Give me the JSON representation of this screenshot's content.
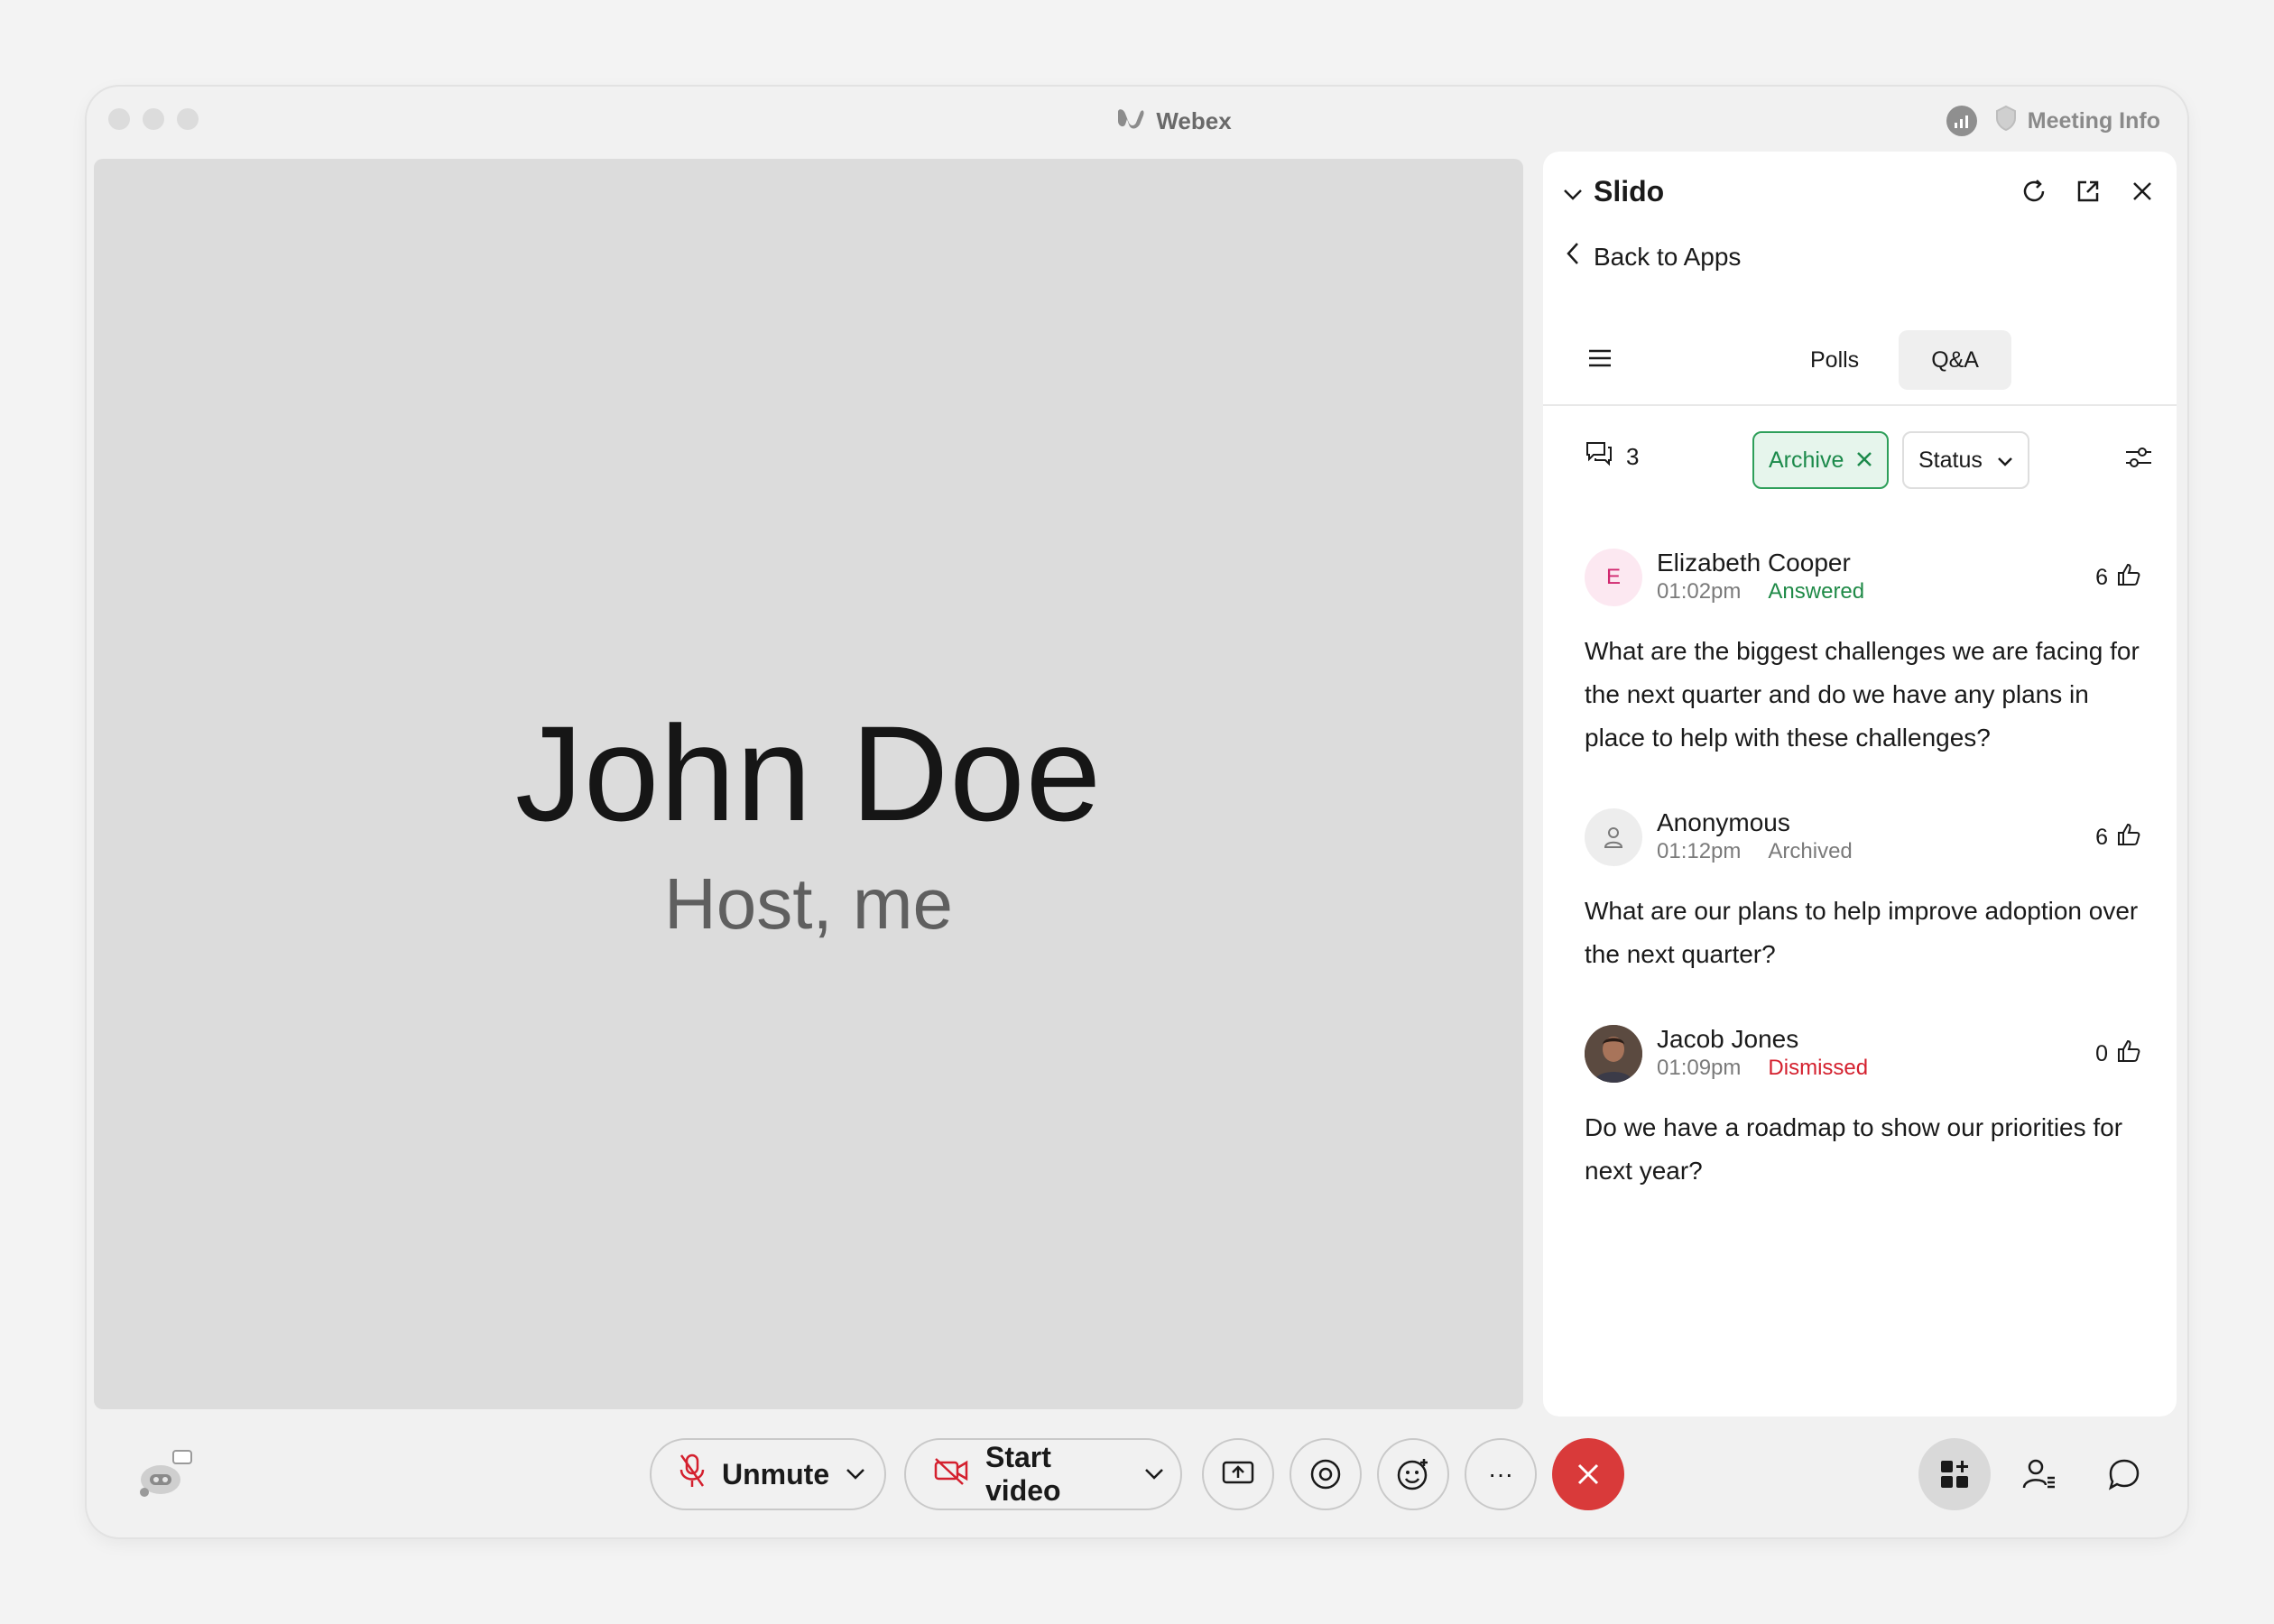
{
  "window": {
    "app_title": "Webex",
    "meeting_info": "Meeting Info"
  },
  "stage": {
    "participant_name": "John Doe",
    "participant_role": "Host, me"
  },
  "slido": {
    "title": "Slido",
    "back_label": "Back to Apps",
    "tabs": [
      {
        "label": "Polls",
        "active": false
      },
      {
        "label": "Q&A",
        "active": true
      }
    ],
    "question_count": "3",
    "filter_archive": "Archive",
    "filter_status": "Status",
    "questions": [
      {
        "author": "Elizabeth Cooper",
        "initial": "E",
        "time": "01:02pm",
        "status": "Answered",
        "votes": "6",
        "text": "What are the biggest challenges we are facing for the next quarter and do we have any plans in place to help with these challenges?"
      },
      {
        "author": "Anonymous",
        "time": "01:12pm",
        "status": "Archived",
        "votes": "6",
        "text": "What are our plans to help improve adoption over the next quarter?"
      },
      {
        "author": "Jacob Jones",
        "time": "01:09pm",
        "status": "Dismissed",
        "votes": "0",
        "text": "Do we have a roadmap to show our priorities for next year?"
      }
    ]
  },
  "controls": {
    "unmute_label": "Unmute",
    "video_label": "Start video",
    "more_label": "···"
  },
  "colors": {
    "answered": "#1f8a47",
    "dismissed": "#d4202e",
    "end_call": "#d93a3a",
    "archive_chip": "#2e9f5a"
  }
}
